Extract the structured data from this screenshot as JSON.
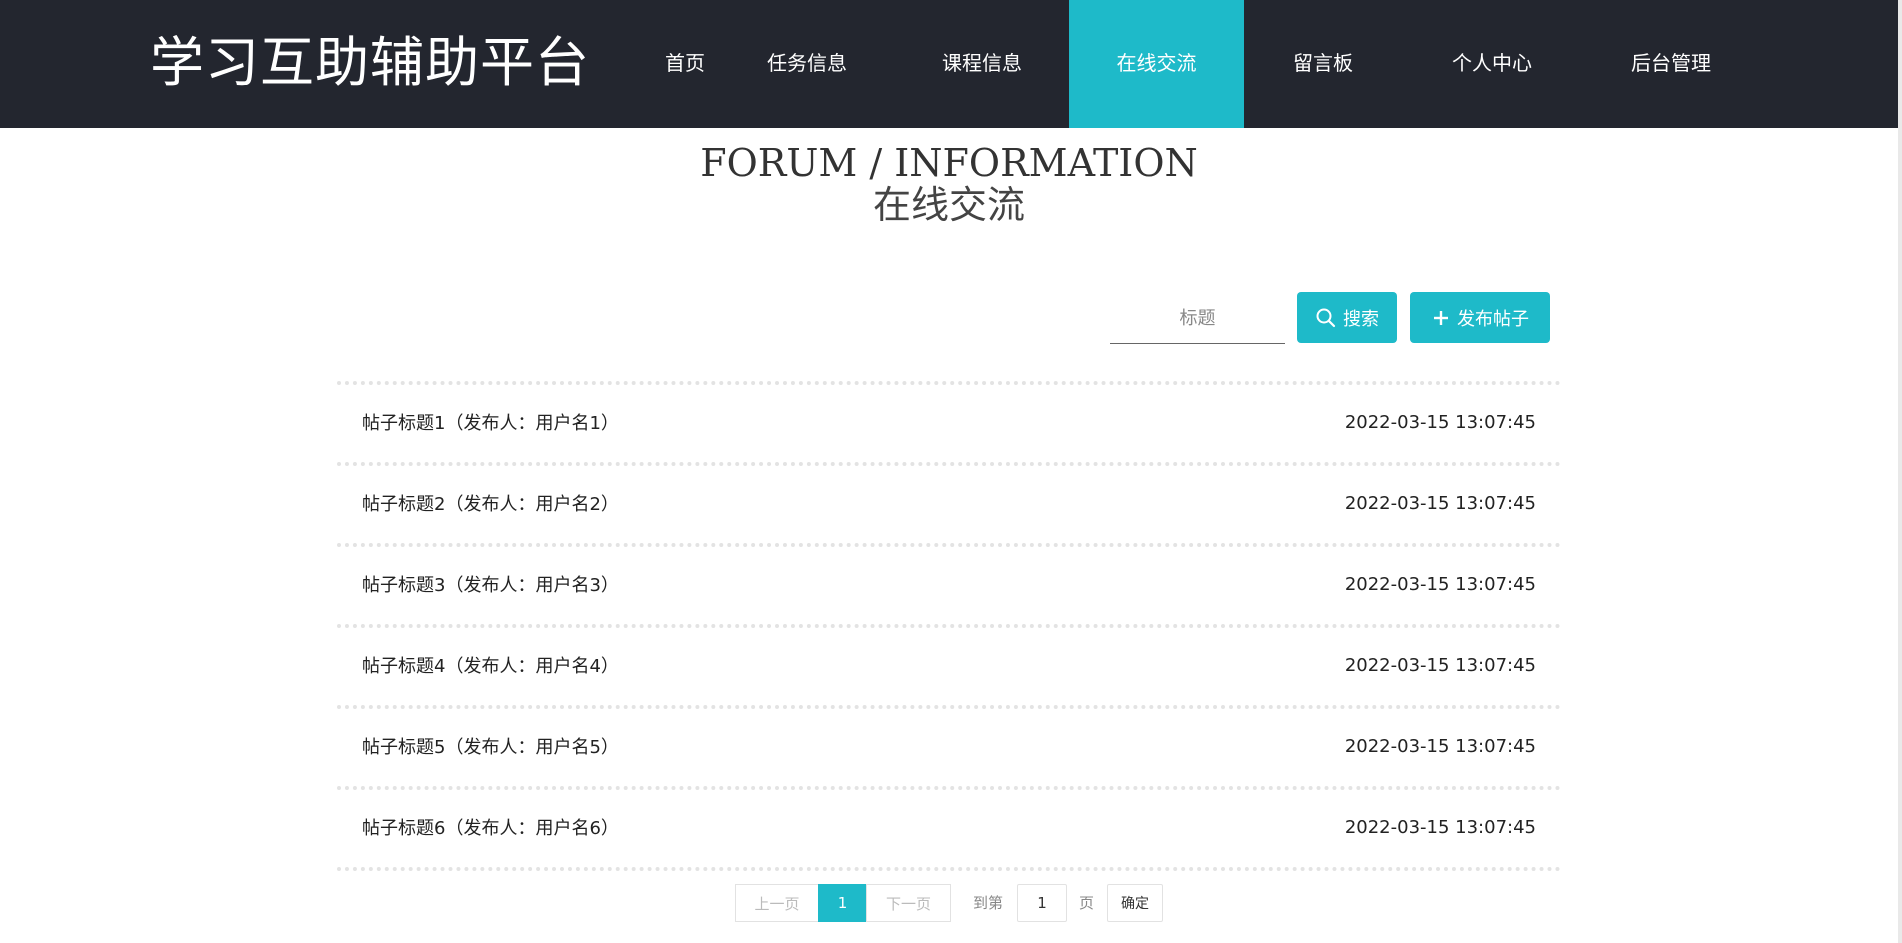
{
  "header": {
    "logo": "学习互助辅助平台",
    "nav": [
      {
        "label": "首页",
        "name": "nav-home"
      },
      {
        "label": "任务信息",
        "name": "nav-tasks"
      },
      {
        "label": "课程信息",
        "name": "nav-courses"
      },
      {
        "label": "在线交流",
        "name": "nav-forum",
        "active": true
      },
      {
        "label": "留言板",
        "name": "nav-messages"
      },
      {
        "label": "个人中心",
        "name": "nav-profile"
      },
      {
        "label": "后台管理",
        "name": "nav-admin"
      }
    ]
  },
  "page": {
    "title_en": "FORUM / INFORMATION",
    "title_zh": "在线交流"
  },
  "search": {
    "placeholder": "标题",
    "search_label": "搜索",
    "add_label": "发布帖子"
  },
  "posts": [
    {
      "title": "帖子标题1（发布人：用户名1）",
      "time": "2022-03-15 13:07:45"
    },
    {
      "title": "帖子标题2（发布人：用户名2）",
      "time": "2022-03-15 13:07:45"
    },
    {
      "title": "帖子标题3（发布人：用户名3）",
      "time": "2022-03-15 13:07:45"
    },
    {
      "title": "帖子标题4（发布人：用户名4）",
      "time": "2022-03-15 13:07:45"
    },
    {
      "title": "帖子标题5（发布人：用户名5）",
      "time": "2022-03-15 13:07:45"
    },
    {
      "title": "帖子标题6（发布人：用户名6）",
      "time": "2022-03-15 13:07:45"
    }
  ],
  "pagination": {
    "prev_label": "上一页",
    "current": "1",
    "next_label": "下一页",
    "goto_label": "到第",
    "goto_value": "1",
    "page_label": "页",
    "confirm_label": "确定"
  },
  "colors": {
    "header_bg": "#23262f",
    "accent": "#1ebac9"
  }
}
